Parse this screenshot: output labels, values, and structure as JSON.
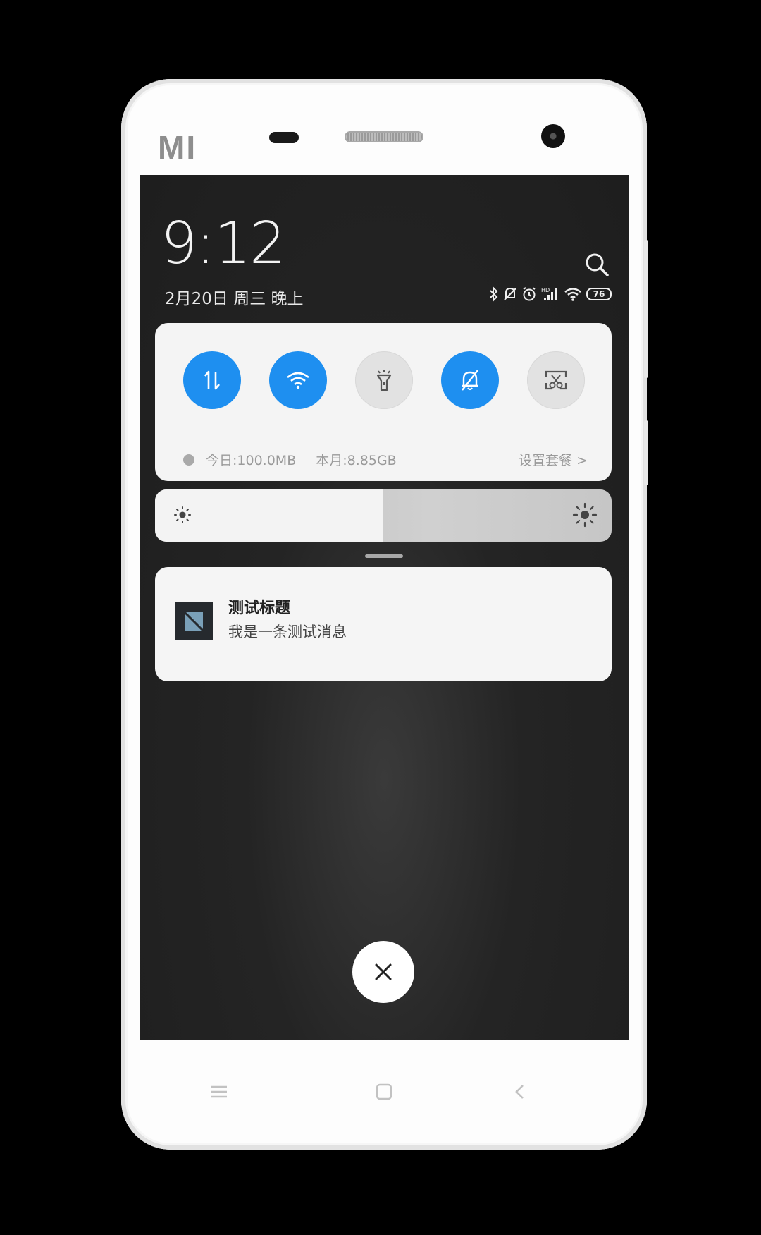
{
  "device": {
    "brand": "MI"
  },
  "lockscreen": {
    "time": "9:12",
    "date": "2月20日 周三 晚上",
    "battery_level": "76"
  },
  "quick_settings": {
    "toggles": [
      {
        "name": "mobile-data",
        "state": "on"
      },
      {
        "name": "wifi",
        "state": "on"
      },
      {
        "name": "flashlight",
        "state": "off"
      },
      {
        "name": "silent",
        "state": "on"
      },
      {
        "name": "screenshot",
        "state": "off"
      }
    ],
    "today_usage": "今日:100.0MB",
    "month_usage": "本月:8.85GB",
    "plan_link": "设置套餐 >"
  },
  "brightness": {
    "level_percent": 50
  },
  "notification": {
    "title": "测试标题",
    "body": "我是一条测试消息"
  },
  "colors": {
    "accent": "#1e8ff0",
    "panel": "#f4f4f4",
    "screen_bg": "#222222"
  }
}
